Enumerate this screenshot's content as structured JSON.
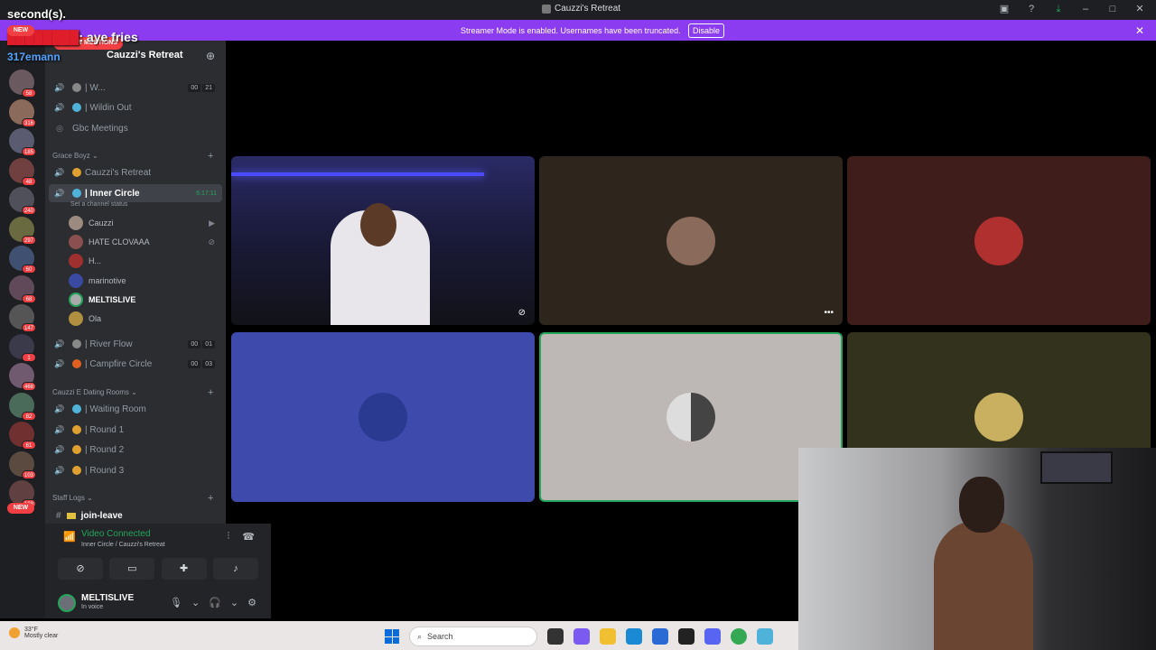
{
  "window": {
    "title": "Cauzzi's Retreat"
  },
  "banner": {
    "message": "Streamer Mode is enabled. Usernames have been truncated.",
    "disable_label": "Disable"
  },
  "overlay": {
    "line1": "second(s).",
    "line2_text": "aye fries",
    "line3_user": "317emann",
    "new_badge": "NEW"
  },
  "rail": {
    "badges": [
      "58",
      "316",
      "185",
      "48",
      "240",
      "297",
      "60",
      "68",
      "147",
      "1",
      "468",
      "82",
      "61",
      "103",
      "188"
    ]
  },
  "server": {
    "name": "Cauzzi's Retreat",
    "new_mentions": "82 NEW MENTIONS"
  },
  "channels_top": [
    {
      "label": "| W...",
      "users": [
        "00",
        "21"
      ]
    },
    {
      "label": "| Wildin Out"
    },
    {
      "label": "Gbc Meetings"
    }
  ],
  "categories": {
    "grace": "Grace Boyz",
    "dating": "Cauzzi E Dating Rooms",
    "staff": "Staff Logs"
  },
  "grace_channels": [
    {
      "label": "Cauzzi's Retreat"
    },
    {
      "label": "| Inner Circle",
      "timer": "6:17:11",
      "status": "Set a channel status"
    }
  ],
  "voice_users": [
    {
      "name": "Cauzzi"
    },
    {
      "name": "HATE CLOVAAA"
    },
    {
      "name": "H..."
    },
    {
      "name": "marinotive"
    },
    {
      "name": "MELTISLIVE"
    },
    {
      "name": "Ola"
    }
  ],
  "more_channels": [
    {
      "label": "| River Flow",
      "users": [
        "00",
        "01"
      ]
    },
    {
      "label": "| Campfire Circle",
      "users": [
        "00",
        "03"
      ]
    }
  ],
  "dating_channels": [
    {
      "label": "| Waiting Room"
    },
    {
      "label": "| Round 1"
    },
    {
      "label": "| Round 2"
    },
    {
      "label": "| Round 3"
    }
  ],
  "staff_channel": "join-leave",
  "voice_panel": {
    "status": "Video Connected",
    "location": "Inner Circle / Cauzzi's Retreat"
  },
  "user": {
    "name": "MELTISLIVE",
    "status": "In voice"
  },
  "taskbar": {
    "temp": "33°F",
    "weather": "Mostly clear",
    "search_placeholder": "Search"
  },
  "colors": {
    "accent": "#8c3cf0",
    "online": "#23a55a",
    "danger": "#f23f43"
  }
}
